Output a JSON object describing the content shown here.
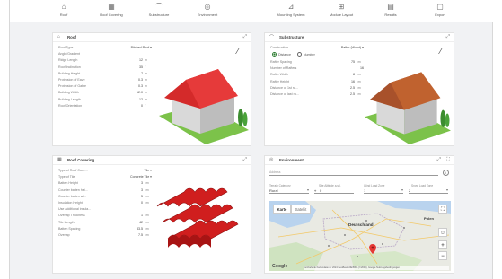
{
  "toolbar": {
    "left_items": [
      {
        "label": "Roof",
        "icon": "roof-icon"
      },
      {
        "label": "Roof Covering",
        "icon": "roof-covering-icon"
      },
      {
        "label": "Substructure",
        "icon": "substructure-icon"
      },
      {
        "label": "Environment",
        "icon": "globe-icon"
      }
    ],
    "right_items": [
      {
        "label": "Mounting System",
        "icon": "mounting-system-icon"
      },
      {
        "label": "Module Layout",
        "icon": "module-layout-icon"
      },
      {
        "label": "Results",
        "icon": "results-icon"
      },
      {
        "label": "Export",
        "icon": "export-icon"
      }
    ]
  },
  "roof": {
    "title": "Roof",
    "rows": [
      {
        "label": "Roof Type",
        "value": "Pitched Roof ▾",
        "unit": ""
      },
      {
        "label": "Angle/Gradient",
        "value": "",
        "unit": ""
      },
      {
        "label": "Ridge Length",
        "value": "12",
        "unit": "m"
      },
      {
        "label": "Roof Inclination",
        "value": "35",
        "unit": "°"
      },
      {
        "label": "Building Height",
        "value": "7",
        "unit": "m"
      },
      {
        "label": "Protrusion of Eave",
        "value": "0.3",
        "unit": "m"
      },
      {
        "label": "Protrusion of Gable",
        "value": "0.3",
        "unit": "m"
      },
      {
        "label": "Building Width",
        "value": "12.0",
        "unit": "m"
      },
      {
        "label": "Building Length",
        "value": "12",
        "unit": "m"
      },
      {
        "label": "Roof Orientation",
        "value": "0",
        "unit": "°"
      }
    ]
  },
  "substructure": {
    "title": "Substructure",
    "construction_label": "Construction",
    "construction_value": "Rafter (Wood) ▾",
    "radio_distance": "Distance",
    "radio_number": "Number",
    "rows": [
      {
        "label": "Rafter Spacing",
        "value": "75",
        "unit": "cm"
      },
      {
        "label": "Number of Rafters",
        "value": "16",
        "unit": ""
      },
      {
        "label": "Rafter Width",
        "value": "8",
        "unit": "cm"
      },
      {
        "label": "Rafter Height",
        "value": "16",
        "unit": "cm"
      },
      {
        "label": "Distance of 1st ra...",
        "value": "2.5",
        "unit": "cm"
      },
      {
        "label": "Distance of last ra...",
        "value": "2.5",
        "unit": "cm"
      }
    ]
  },
  "roof_covering": {
    "title": "Roof Covering",
    "rows": [
      {
        "label": "Type of Roof Cove...",
        "value": "Tile ▾",
        "unit": ""
      },
      {
        "label": "Type of Tile",
        "value": "Concrete Tile ▾",
        "unit": ""
      },
      {
        "label": "Batten Height",
        "value": "3",
        "unit": "cm"
      },
      {
        "label": "Counter batten hei...",
        "value": "3",
        "unit": "cm"
      },
      {
        "label": "Counter batten wi...",
        "value": "5",
        "unit": "cm"
      },
      {
        "label": "Insulation Height",
        "value": "0",
        "unit": "cm"
      },
      {
        "label": "Use additional insula...",
        "value": "",
        "unit": ""
      },
      {
        "label": "Overlap Thickness",
        "value": "1",
        "unit": "cm"
      },
      {
        "label": "Tile Length",
        "value": "42",
        "unit": "cm"
      },
      {
        "label": "Batten Spacing",
        "value": "33.5",
        "unit": "cm"
      },
      {
        "label": "Overlap",
        "value": "7.5",
        "unit": "cm"
      }
    ]
  },
  "environment": {
    "title": "Environment",
    "address_label": "Address",
    "fields": [
      {
        "label": "Terrain Category",
        "value": "Rural"
      },
      {
        "label": "Site Altitude a.s.l.",
        "value": "0"
      },
      {
        "label": "Wind Load Zone",
        "value": "1"
      },
      {
        "label": "Snow Load Zone",
        "value": "2"
      }
    ],
    "map": {
      "tab_map": "Karte",
      "tab_satellite": "Satellit",
      "country_label": "Deutschland",
      "poland_label": "Polen",
      "google_label": "Google",
      "footer": "Kurzbefehle  Kartendaten © 2024 GeoBasis-DE/BKG (©2009), Google  Nutzungsbedingungen"
    }
  },
  "colors": {
    "roof_red": "#d42a2a",
    "roof_brown": "#a8512b",
    "grass": "#7cc24a",
    "accent_green": "#2e7d32"
  }
}
